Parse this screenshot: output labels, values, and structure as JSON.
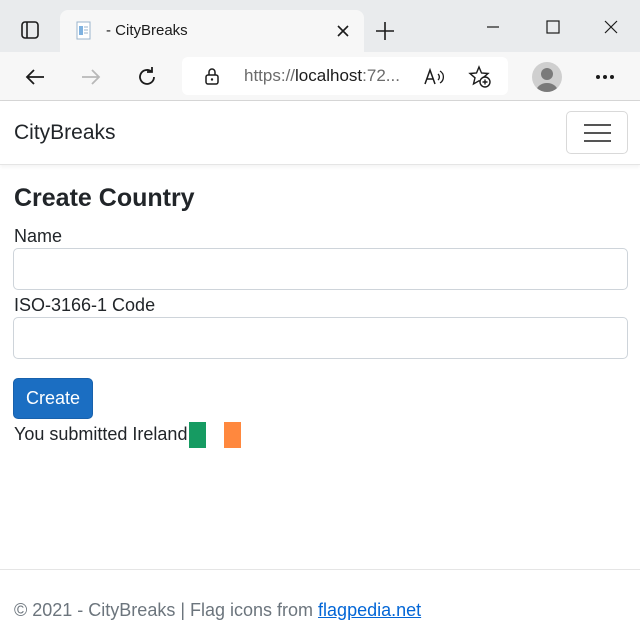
{
  "browser": {
    "tab_title": "- CityBreaks",
    "url_prefix": "https://",
    "url_host": "localhost",
    "url_rest": ":72..."
  },
  "navbar": {
    "brand": "CityBreaks"
  },
  "form": {
    "heading": "Create Country",
    "name_label": "Name",
    "name_value": "",
    "code_label": "ISO-3166-1 Code",
    "code_value": "",
    "submit_label": "Create"
  },
  "result": {
    "text": "You submitted Ireland",
    "flag_colors": [
      "#169b62",
      "#ffffff",
      "#ff883e"
    ]
  },
  "footer": {
    "text": "© 2021 - CityBreaks | Flag icons from ",
    "link_text": "flagpedia.net"
  },
  "colors": {
    "primary": "#1b6ec2",
    "link": "#0366d6"
  }
}
